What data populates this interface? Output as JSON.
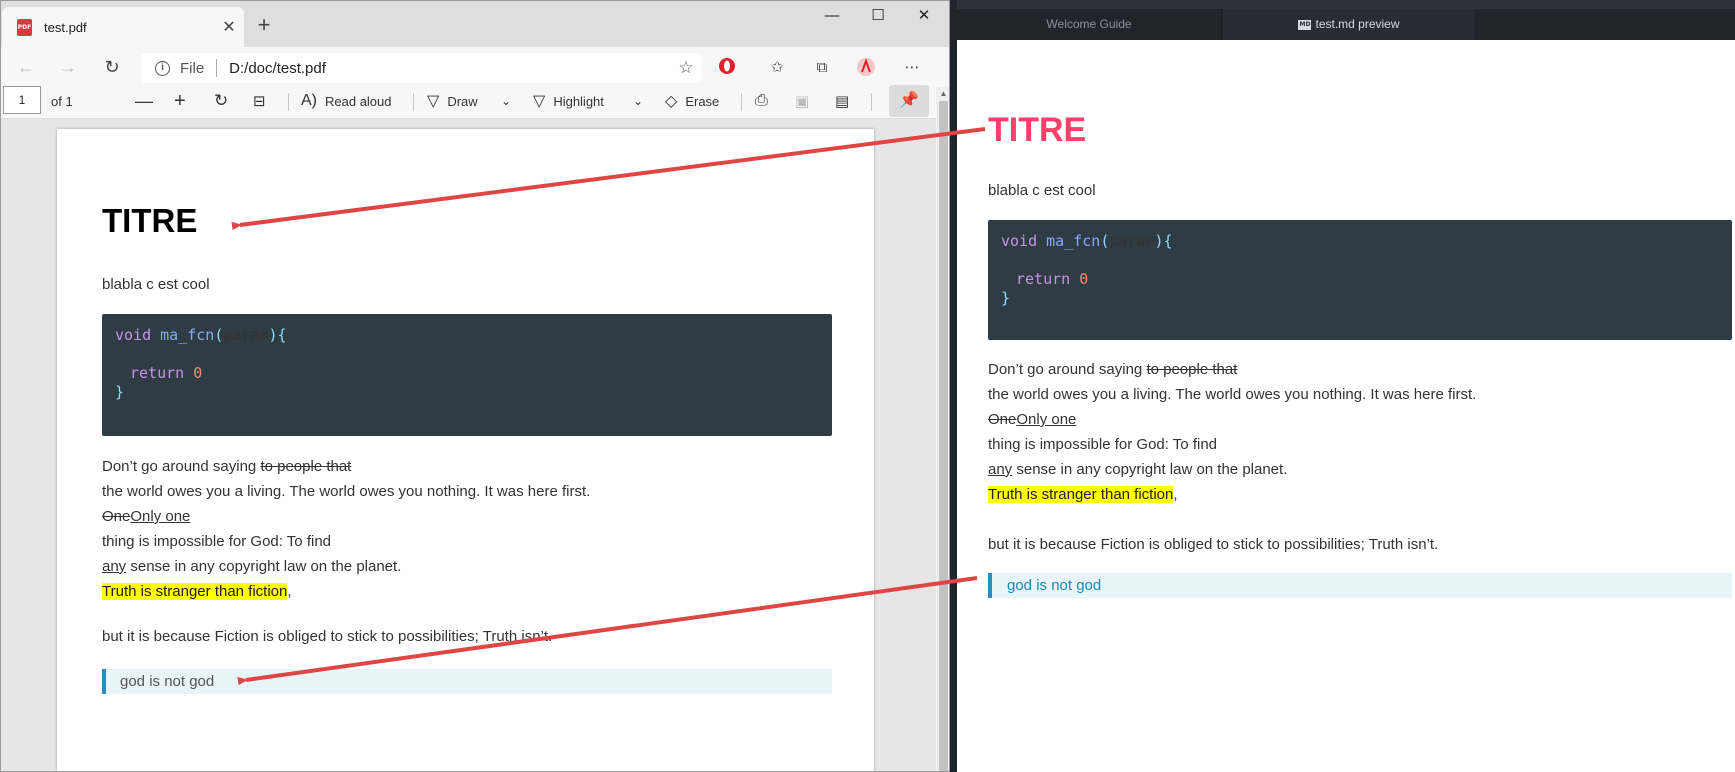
{
  "browser": {
    "tab_title": "test.pdf",
    "tab_close": "✕",
    "new_tab": "+",
    "window_controls": [
      "—",
      "☐",
      "✕"
    ],
    "url_scheme": "File",
    "url": "D:/doc/test.pdf",
    "pdf_icon": "PDF"
  },
  "pdf_toolbar": {
    "page_number": "1",
    "page_of": "of 1",
    "read_aloud": "Read aloud",
    "draw": "Draw",
    "highlight": "Highlight",
    "erase": "Erase"
  },
  "atom": {
    "tabs": [
      "Welcome Guide",
      "test.md preview"
    ],
    "md_badge": "MD"
  },
  "doc": {
    "title": "TITRE",
    "intro": "blabla c est cool",
    "code_line1_kw": "void",
    "code_line1_fn": "ma_fcn",
    "code_line1_open": "(",
    "code_line1_param": "param",
    "code_line1_close": "){",
    "code_line2_kw": "return",
    "code_line2_num": "0",
    "code_line3": "}",
    "p1_a": "Don’t go around saying ",
    "p1_strike": "to people that",
    "p2": "the world owes you a living. The world owes you nothing. It was here first.",
    "p3_strike": "One",
    "p3_ins": "Only one",
    "p4": "thing is impossible for God: To find",
    "p5_ins": "any",
    "p5_rest": " sense in any copyright law on the planet.",
    "p6_hl": "Truth is stranger than fiction",
    "p6_comma": ",",
    "p7": "but it is because Fiction is obliged to stick to possibilities; Truth isn’t.",
    "quote": "god is not god"
  },
  "colors": {
    "atom_title": "#f7406b",
    "quote_text_atom": "#1b8bb0",
    "arrow": "#e04545",
    "code_bg": "#2f3c43"
  }
}
